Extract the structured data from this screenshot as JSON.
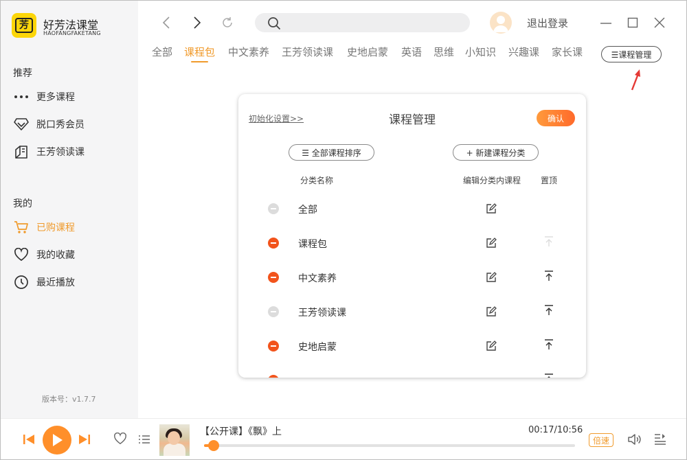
{
  "app": {
    "name": "好芳法课堂",
    "subtitle": "HAOFANGFAKETANG",
    "logo_char": "芳"
  },
  "sidebar": {
    "section_recommend": "推荐",
    "recommend_items": [
      {
        "label": "更多课程",
        "icon": "more-dots-icon"
      },
      {
        "label": "脱口秀会员",
        "icon": "diamond-icon"
      },
      {
        "label": "王芳领读课",
        "icon": "book-icon"
      }
    ],
    "section_mine": "我的",
    "mine_items": [
      {
        "label": "已购课程",
        "icon": "cart-icon",
        "active": true
      },
      {
        "label": "我的收藏",
        "icon": "heart-icon"
      },
      {
        "label": "最近播放",
        "icon": "clock-icon"
      }
    ],
    "version": "版本号：v1.7.7"
  },
  "topbar": {
    "search_placeholder": "",
    "logout": "退出登录"
  },
  "tabs": [
    {
      "label": "全部"
    },
    {
      "label": "课程包",
      "active": true
    },
    {
      "label": "中文素养"
    },
    {
      "label": "王芳领读课"
    },
    {
      "label": "史地启蒙"
    },
    {
      "label": "英语"
    },
    {
      "label": "思维"
    },
    {
      "label": "小知识"
    },
    {
      "label": "兴趣课"
    },
    {
      "label": "家长课"
    }
  ],
  "manage_button": "☰课程管理",
  "dialog": {
    "init_link": "初始化设置>>",
    "title": "课程管理",
    "confirm": "确认",
    "sort_all": "☰ 全部课程排序",
    "new_category": "+ 新建课程分类",
    "col_name": "分类名称",
    "col_edit": "编辑分类内课程",
    "col_top": "置顶",
    "rows": [
      {
        "name": "全部",
        "removable": false,
        "top": "none"
      },
      {
        "name": "课程包",
        "removable": true,
        "top": "disabled"
      },
      {
        "name": "中文素养",
        "removable": true,
        "top": "enabled"
      },
      {
        "name": "王芳领读课",
        "removable": false,
        "top": "enabled"
      },
      {
        "name": "史地启蒙",
        "removable": true,
        "top": "enabled"
      }
    ]
  },
  "player": {
    "track": "【公开课】《飘》上",
    "time": "00:17/10:56",
    "progress": 0.026,
    "speed": "倍速"
  },
  "colors": {
    "accent": "#f09a2b",
    "remove": "#f2541c",
    "play": "#ff8f2a"
  }
}
